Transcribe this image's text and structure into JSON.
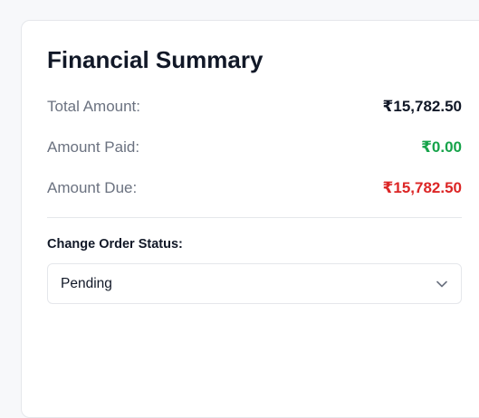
{
  "summary": {
    "title": "Financial Summary",
    "total_label": "Total Amount:",
    "total_value": "₹15,782.50",
    "paid_label": "Amount Paid:",
    "paid_value": "₹0.00",
    "due_label": "Amount Due:",
    "due_value": "₹15,782.50"
  },
  "status": {
    "label": "Change Order Status:",
    "selected": "Pending",
    "icon": "chevron-down-icon"
  },
  "colors": {
    "total": "#111827",
    "paid": "#16a34a",
    "due": "#dc2626"
  }
}
